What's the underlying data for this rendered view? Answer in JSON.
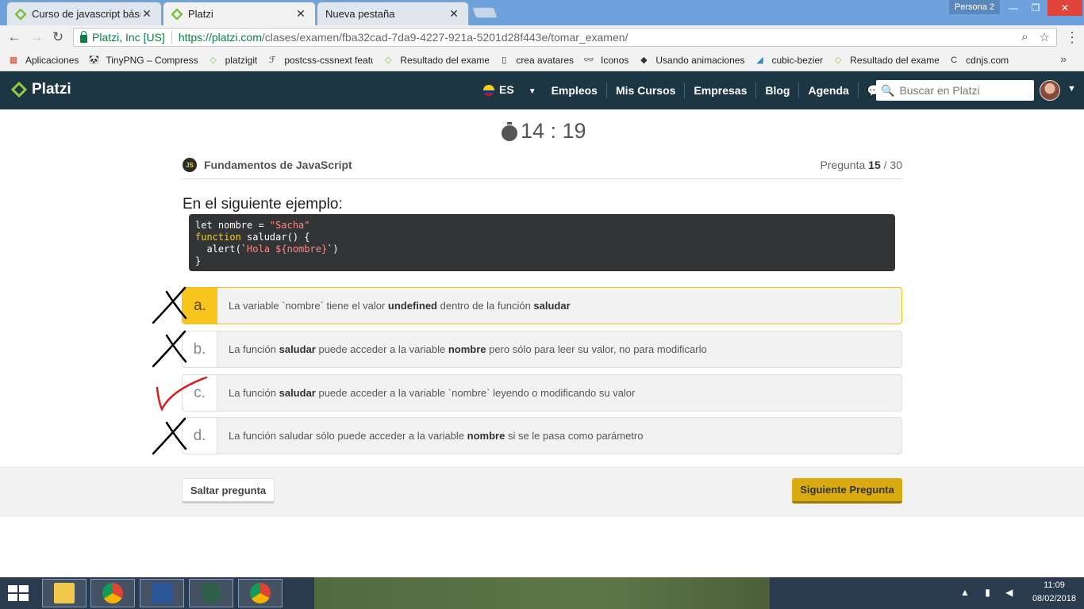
{
  "browser": {
    "tabs": [
      {
        "label": "Curso de javascript básico"
      },
      {
        "label": "Platzi"
      },
      {
        "label": "Nueva pestaña"
      }
    ],
    "persona": "Persona 2",
    "secure_label": "Platzi, Inc [US]",
    "url_host": "https://platzi.com",
    "url_path": "/clases/examen/fba32cad-7da9-4227-921a-5201d28f443e/tomar_examen/"
  },
  "bookmarks": [
    {
      "label": "Aplicaciones",
      "icon": "apps-grid-icon"
    },
    {
      "label": "TinyPNG – Compress",
      "icon": "panda-icon"
    },
    {
      "label": "platzigit",
      "icon": "platzi-icon"
    },
    {
      "label": "postcss-cssnext featu",
      "icon": "postcss-icon"
    },
    {
      "label": "Resultado del examen",
      "icon": "platzi-icon"
    },
    {
      "label": "crea avatares",
      "icon": "page-icon"
    },
    {
      "label": "Iconos",
      "icon": "glasses-icon"
    },
    {
      "label": "Usando animaciones",
      "icon": "bird-icon"
    },
    {
      "label": "cubic-bezier",
      "icon": "curve-icon"
    },
    {
      "label": "Resultado del examen",
      "icon": "platzi-icon"
    },
    {
      "label": "cdnjs.com",
      "icon": "cdnjs-icon"
    }
  ],
  "header": {
    "logo": "Platzi",
    "lang": "ES",
    "nav": [
      "Empleos",
      "Mis Cursos",
      "Empresas",
      "Blog",
      "Agenda"
    ],
    "search_placeholder": "Buscar en Platzi"
  },
  "exam": {
    "timer": "14 : 19",
    "course_badge": "JS",
    "course": "Fundamentos de JavaScript",
    "counter_label": "Pregunta",
    "counter_current": "15",
    "counter_total": "/ 30",
    "question": "En el siguiente ejemplo:",
    "code": {
      "l1_a": "let nombre = ",
      "l1_b": "\"Sacha\"",
      "l2_kw": "function",
      "l2_rest": " saludar() {",
      "l3_a": "  alert(`",
      "l3_b": "Hola ${nombre}",
      "l3_c": "`)",
      "l4": "}"
    },
    "options": [
      {
        "letter": "a.",
        "selected": true,
        "mark": "cross",
        "parts": [
          {
            "t": "La variable `nombre` tiene el valor "
          },
          {
            "t": "undefined",
            "b": true
          },
          {
            "t": " dentro de la función "
          },
          {
            "t": "saludar",
            "b": true
          }
        ]
      },
      {
        "letter": "b.",
        "selected": false,
        "mark": "cross",
        "parts": [
          {
            "t": "La función "
          },
          {
            "t": "saludar",
            "b": true
          },
          {
            "t": " puede acceder a la variable "
          },
          {
            "t": "nombre",
            "b": true
          },
          {
            "t": " pero sólo para leer su valor, no para modificarlo"
          }
        ]
      },
      {
        "letter": "c.",
        "selected": false,
        "mark": "check",
        "parts": [
          {
            "t": "La función "
          },
          {
            "t": "saludar",
            "b": true
          },
          {
            "t": " puede acceder a la variable `nombre` leyendo o modificando su valor"
          }
        ]
      },
      {
        "letter": "d.",
        "selected": false,
        "mark": "cross",
        "parts": [
          {
            "t": "La función saludar sólo puede acceder a la variable "
          },
          {
            "t": "nombre",
            "b": true
          },
          {
            "t": " si se le pasa como parámetro"
          }
        ]
      }
    ],
    "skip_label": "Saltar pregunta",
    "next_label": "Siguiente Pregunta"
  },
  "colors": {
    "header_bg": "#1c3643",
    "accent_yellow": "#f7c51e",
    "next_button": "#d9ab10",
    "cross_mark": "#000000",
    "check_mark": "#e01b1b"
  },
  "taskbar": {
    "apps": [
      "file-explorer-icon",
      "chrome-icon",
      "word-icon",
      "atom-icon",
      "chrome-icon"
    ],
    "time": "11:09",
    "date": "08/02/2018"
  }
}
